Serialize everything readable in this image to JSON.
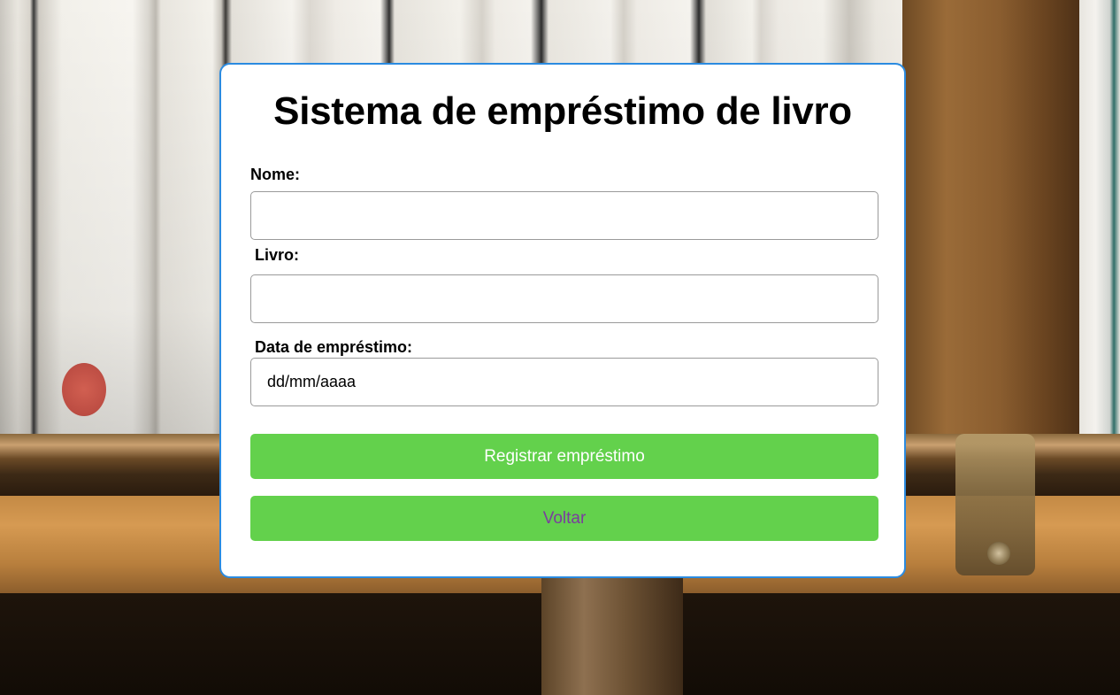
{
  "form": {
    "title": "Sistema de empréstimo de livro",
    "fields": {
      "nome": {
        "label": "Nome:",
        "value": ""
      },
      "livro": {
        "label": "Livro:",
        "value": ""
      },
      "data": {
        "label": "Data de empréstimo:",
        "placeholder": "dd/mm/aaaa"
      }
    },
    "buttons": {
      "submit": "Registrar empréstimo",
      "back": "Voltar"
    }
  },
  "colors": {
    "card_border": "#2b8be0",
    "button_bg": "#63d14c",
    "submit_text": "#ffffff",
    "back_text": "#7a3d9e"
  },
  "background": {
    "description_icon": "bookshelf-background"
  }
}
